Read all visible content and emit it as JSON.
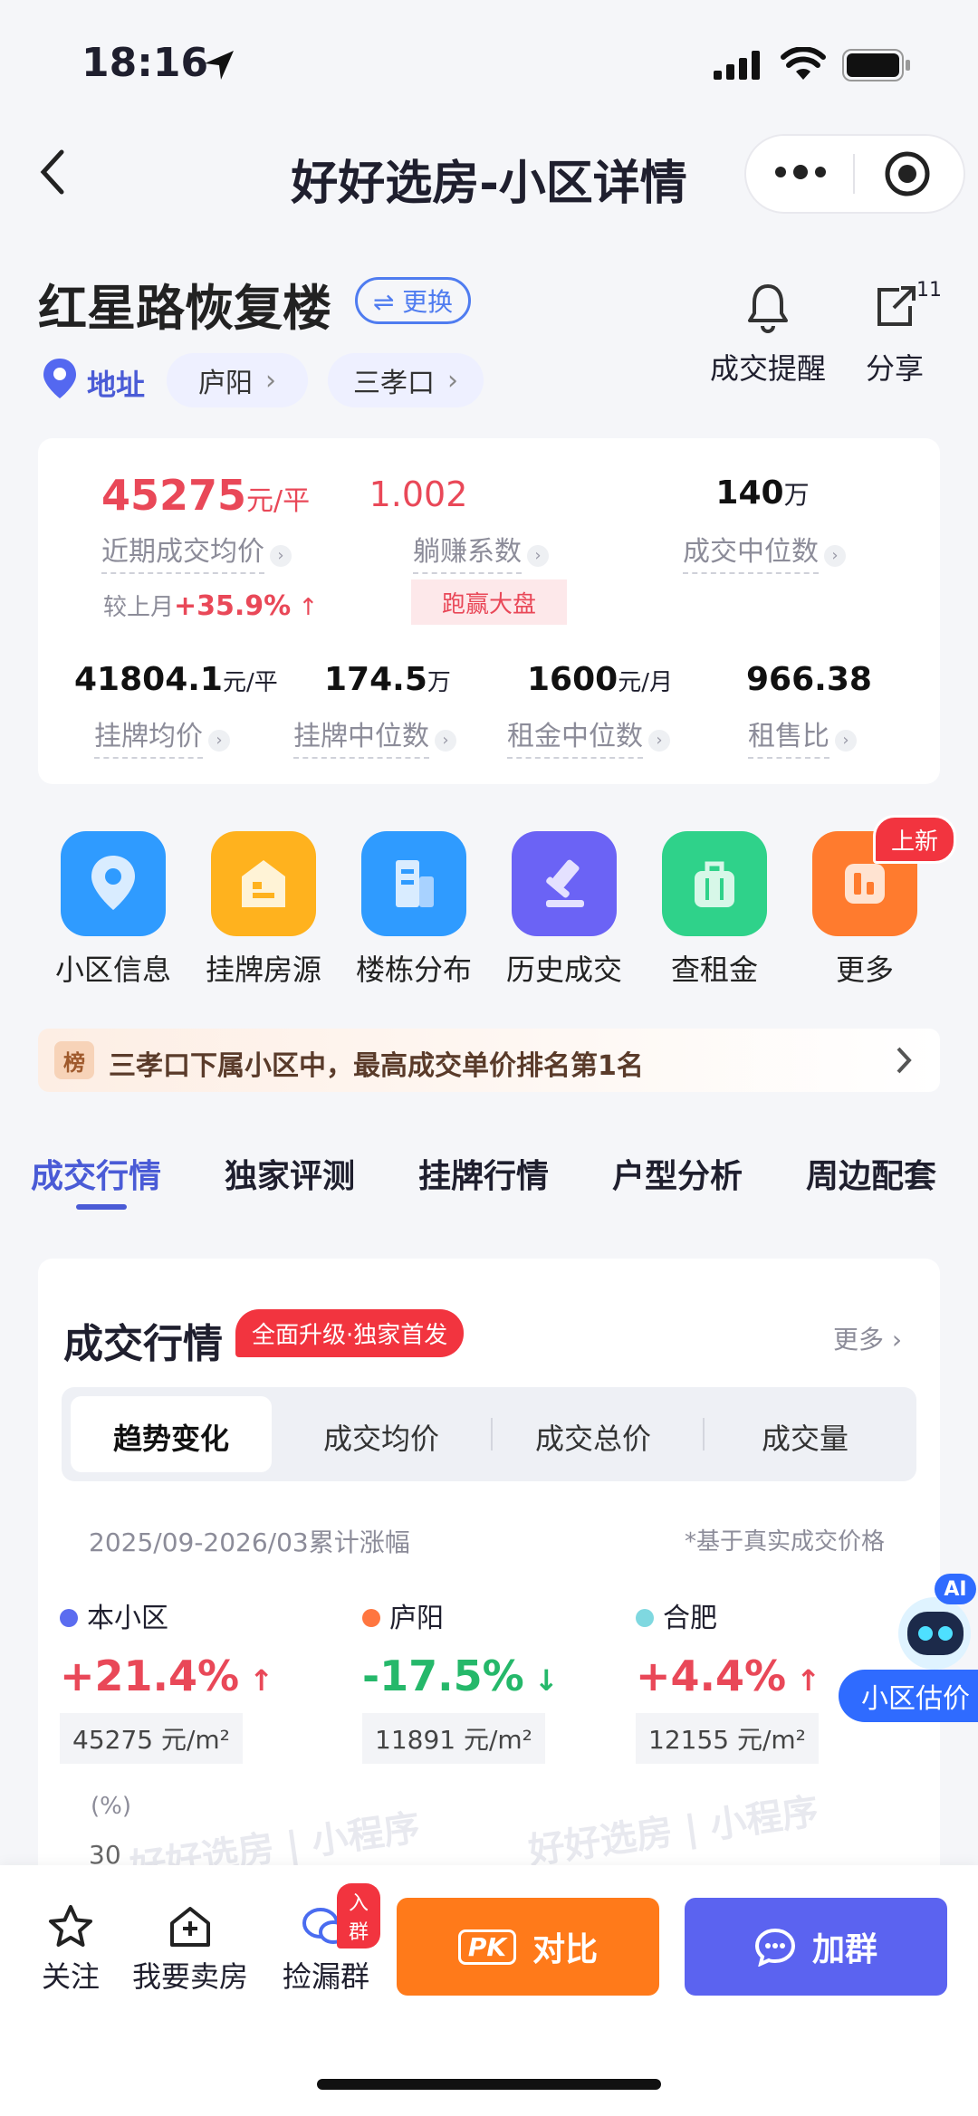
{
  "status": {
    "time": "18:16"
  },
  "nav": {
    "title": "好好选房-小区详情"
  },
  "community": {
    "name": "红星路恢复楼",
    "switch_label": "⇌ 更换",
    "address_label": "地址",
    "district_tag": "庐阳",
    "area_tag": "三孝口",
    "alert_label": "成交提醒",
    "share_label": "分享",
    "share_badge": "11"
  },
  "metrics": {
    "avg_price": {
      "value": "45275",
      "unit": "元/平",
      "label": "近期成交均价"
    },
    "coefficient": {
      "value": "1.002",
      "label": "躺赚系数",
      "badge": "跑赢大盘"
    },
    "median_deal": {
      "value": "140",
      "unit": "万",
      "label": "成交中位数"
    },
    "mom": {
      "label": "较上月",
      "value": "+35.9%"
    },
    "listing_avg": {
      "value": "41804.1",
      "unit": "元/平",
      "label": "挂牌均价"
    },
    "listing_median": {
      "value": "174.5",
      "unit": "万",
      "label": "挂牌中位数"
    },
    "rent_median": {
      "value": "1600",
      "unit": "元/月",
      "label": "租金中位数"
    },
    "rent_ratio": {
      "value": "966.38",
      "label": "租售比"
    }
  },
  "menu": [
    {
      "label": "小区信息",
      "color": "#2f9bff"
    },
    {
      "label": "挂牌房源",
      "color": "#ffb21e"
    },
    {
      "label": "楼栋分布",
      "color": "#2f9bff"
    },
    {
      "label": "历史成交",
      "color": "#6b63f5"
    },
    {
      "label": "查租金",
      "color": "#2fd28a"
    },
    {
      "label": "更多",
      "color": "#ff7b2e",
      "badge": "上新"
    }
  ],
  "ranking": {
    "badge": "榜",
    "text": "三孝口下属小区中，最高成交单价排名第1名"
  },
  "tabs": [
    "成交行情",
    "独家评测",
    "挂牌行情",
    "户型分析",
    "周边配套"
  ],
  "deal_section": {
    "title": "成交行情",
    "promo": "全面升级·独家首发",
    "more": "更多",
    "segments": [
      "趋势变化",
      "成交均价",
      "成交总价",
      "成交量"
    ],
    "period": "2025/09-2026/03累计涨幅",
    "note": "*基于真实成交价格",
    "compare": [
      {
        "name": "本小区",
        "dot": "#5b6cf0",
        "change": "+21.4%",
        "color": "#e94858",
        "price": "45275 元/m²"
      },
      {
        "name": "庐阳",
        "dot": "#ff7640",
        "change": "-17.5%",
        "color": "#25b86a",
        "price": "11891 元/m²"
      },
      {
        "name": "合肥",
        "dot": "#7fd8e0",
        "change": "+4.4%",
        "color": "#e94858",
        "price": "12155 元/m²"
      }
    ],
    "unit_label": "(%)",
    "y_tick": "30",
    "watermark": "好好选房 | 小程序"
  },
  "ai_bubble": {
    "badge": "AI",
    "label": "小区估价"
  },
  "bottom": {
    "follow": "关注",
    "sell": "我要卖房",
    "group": "捡漏群",
    "group_badge": "入群",
    "compare": "对比",
    "pk": "PK",
    "join": "加群"
  }
}
